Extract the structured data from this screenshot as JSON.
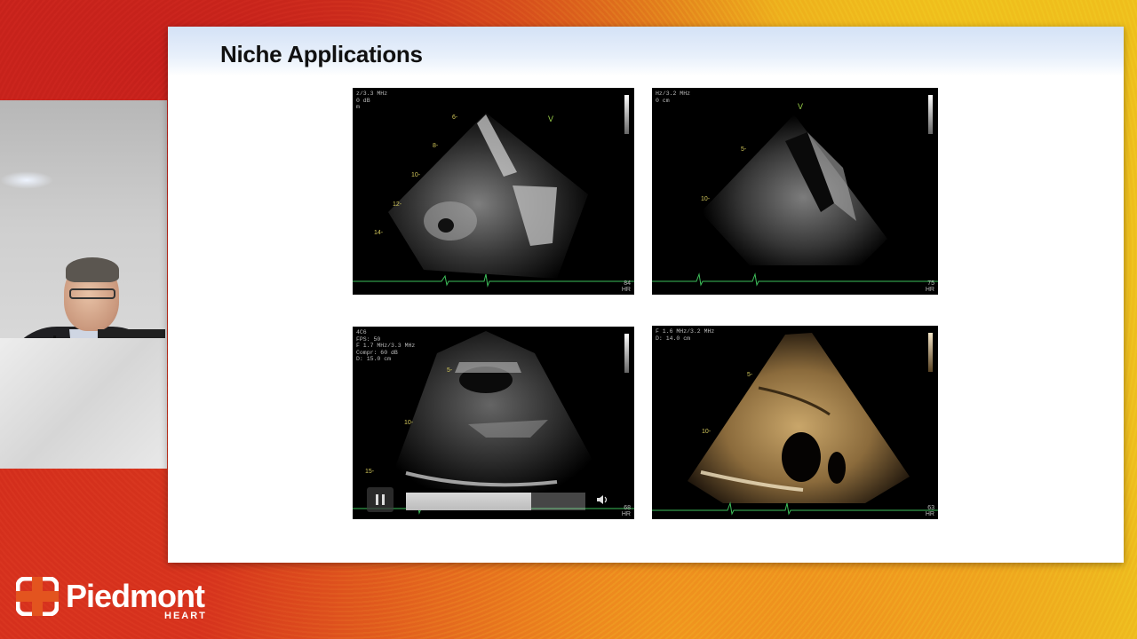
{
  "slide": {
    "title": "Niche Applications"
  },
  "panels": [
    {
      "params": "z/3.3 MHz\n0 dB\nm",
      "depth_marks": [
        "6-",
        "8-",
        "10-",
        "12-",
        "14-"
      ],
      "marker": "V",
      "hr_value": "84",
      "hr_label": "HR"
    },
    {
      "params": "Hz/3.2 MHz\n0 cm",
      "depth_marks": [
        "5-",
        "10-"
      ],
      "marker": "V",
      "hr_value": "75",
      "hr_label": "HR"
    },
    {
      "params": "4C6\nFPS: 50\nF 1.7 MHz/3.3 MHz\nCompr: 60 dB\nD: 15.0 cm",
      "depth_marks": [
        "5-",
        "10-",
        "15-"
      ],
      "hr_value": "68",
      "hr_label": "HR"
    },
    {
      "params": "F 1.6 MHz/3.2 MHz\nD: 14.0 cm",
      "depth_marks": [
        "5-",
        "10-"
      ],
      "hr_value": "63",
      "hr_label": "HR"
    }
  ],
  "video_controls": {
    "progress": 0.7,
    "pause_icon": "pause-icon",
    "volume_icon": "volume-icon"
  },
  "logo": {
    "name": "Piedmont",
    "sub": "HEART"
  },
  "colors": {
    "header_blue": "#d4e2f6",
    "depth_text": "#d2c75a",
    "ecg_green": "#3dbf5a",
    "sepia": "#b08a52"
  }
}
